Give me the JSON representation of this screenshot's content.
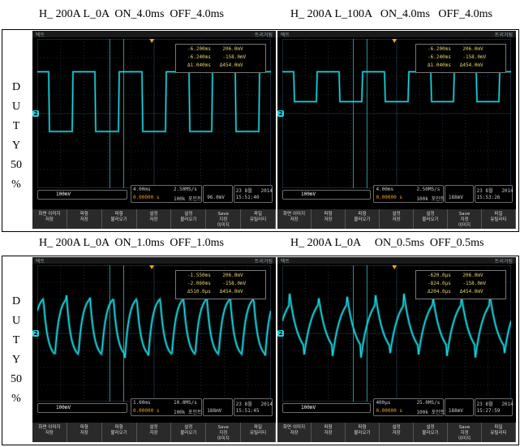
{
  "titles": [
    "H_ 200A L_0A  ON_4.0ms  OFF_4.0ms",
    "H_ 200A L_100A   ON_4.0ms   OFF_4.0ms",
    "H_ 200A L_0A  ON_1.0ms  OFF_1.0ms",
    "H_ 200A L_0A     ON_0.5ms  OFF_0.5ms"
  ],
  "duty_side_label": [
    "D",
    "U",
    "T",
    "Y",
    "50",
    "%"
  ],
  "colors": {
    "trace": "#19d6e0",
    "grid": "#2e4a6a",
    "cursor": "#2fb9c2",
    "trigger": "#f0a020"
  },
  "scopes": [
    {
      "brand": "텍트",
      "mode": "트리거됨",
      "meas_lines": [
        "-6.200ms    206.0mV",
        "-6.240ms    -158.0mV",
        "Δ1.040ms   Δ454.0mV"
      ],
      "ch_scale": "100mV",
      "timebase": "4.00ms",
      "sample_rate": "2.50MS/s",
      "record": "100k 포인트",
      "trig_level": "96.0mV",
      "trig_time": "0.00000 s",
      "date": "23 8월   2014",
      "time": "15:51:40",
      "softkeys": [
        "화면 이미지\n저장",
        "파형\n저장",
        "파형\n불러오기",
        "설정\n저장",
        "설정\n불러오기",
        "Save\n지정\n이미지",
        "파일\n유틸리티"
      ],
      "trace": {
        "type": "square",
        "period_divs": 2.0,
        "high": 0.78,
        "low": 0.38,
        "settle": 0.02
      }
    },
    {
      "brand": "텍트",
      "mode": "트리거됨",
      "meas_lines": [
        "-6.200ms    206.0mV",
        "-6.240ms    -158.0mV",
        "Δ1.040ms   Δ454.0mV"
      ],
      "ch_scale": "100mV",
      "timebase": "4.00ms",
      "sample_rate": "2.50MS/s",
      "record": "100k 포인트",
      "trig_level": "188mV",
      "trig_time": "0.00000 s",
      "date": "23 8월   2014",
      "time": "15:53:26",
      "softkeys": [
        "화면 이미지\n저장",
        "파형\n저장",
        "파형\n불러오기",
        "설정\n저장",
        "설정\n불러오기",
        "Save\n지정\n이미지",
        "파일\n유틸리티"
      ],
      "trace": {
        "type": "square",
        "period_divs": 2.0,
        "high": 0.78,
        "low": 0.58,
        "settle": 0.02
      }
    },
    {
      "brand": "텍트",
      "mode": "트리거됨",
      "meas_lines": [
        "-1.550ms    206.0mV",
        "-2.060ms    -158.0mV",
        "Δ510.0μs   Δ454.0mV"
      ],
      "ch_scale": "100mV",
      "timebase": "1.00ms",
      "sample_rate": "10.0MS/s",
      "record": "100k 포인트",
      "trig_level": "188mV",
      "trig_time": "0.00000 s",
      "date": "23 8월   2014",
      "time": "15:51:45",
      "softkeys": [
        "화면 이미지\n저장",
        "파형\n저장",
        "파형\n불러오기",
        "설정\n저장",
        "설정\n불러오기",
        "Save\n지정\n이미지",
        "파일\n유틸리티"
      ],
      "trace": {
        "type": "rc",
        "period_divs": 1.0,
        "high": 0.78,
        "low": 0.32,
        "settle": 0.18
      }
    },
    {
      "brand": "텍트",
      "mode": "트리거됨",
      "meas_lines": [
        "-620.0μs    206.0mV",
        "-824.0μs    -158.0mV",
        "Δ204.0μs   Δ454.0mV"
      ],
      "ch_scale": "100mV",
      "timebase": "400μs",
      "sample_rate": "25.0MS/s",
      "record": "100k 포인트",
      "trig_level": "188mV",
      "trig_time": "0.00000 s",
      "date": "23 8월   2014",
      "time": "15:27:59",
      "softkeys": [
        "화면 이미지\n저장",
        "파형\n저장",
        "파형\n불러오기",
        "설정\n저장",
        "설정\n불러오기",
        "Save\n지정\n이미지",
        "파일\n유틸리티"
      ],
      "trace": {
        "type": "rc",
        "period_divs": 1.25,
        "high": 0.8,
        "low": 0.32,
        "settle": 0.3
      }
    }
  ]
}
